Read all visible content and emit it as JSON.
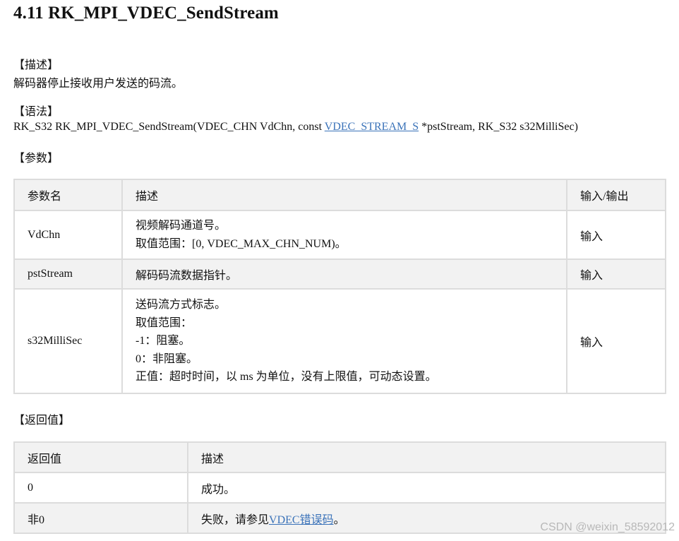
{
  "title": "4.11 RK_MPI_VDEC_SendStream",
  "desc_heading": "【描述】",
  "desc_text": "解码器停止接收用户发送的码流。",
  "syntax_heading": "【语法】",
  "syntax": {
    "before": "RK_S32 RK_MPI_VDEC_SendStream(VDEC_CHN VdChn, const ",
    "link": "VDEC_STREAM_S",
    "after": " *pstStream, RK_S32 s32MilliSec)"
  },
  "params_heading": "【参数】",
  "params_table": {
    "headers": [
      "参数名",
      "描述",
      "输入/输出"
    ],
    "rows": [
      {
        "name": "VdChn",
        "desc": [
          "视频解码通道号。",
          "取值范围：[0, VDEC_MAX_CHN_NUM)。"
        ],
        "io": "输入"
      },
      {
        "name": "pstStream",
        "desc": [
          "解码码流数据指针。"
        ],
        "io": "输入"
      },
      {
        "name": "s32MilliSec",
        "desc": [
          "送码流方式标志。",
          "取值范围：",
          "-1：阻塞。",
          "0：非阻塞。",
          "正值：超时时间，以 ms 为单位，没有上限值，可动态设置。"
        ],
        "io": "输入"
      }
    ]
  },
  "return_heading": "【返回值】",
  "return_table": {
    "headers": [
      "返回值",
      "描述"
    ],
    "rows": [
      {
        "value": "0",
        "desc": "成功。"
      },
      {
        "value": "非0",
        "desc_before": "失败，请参见",
        "desc_link": "VDEC错误码",
        "desc_after": "。"
      }
    ]
  },
  "watermark": "CSDN @weixin_58592012"
}
